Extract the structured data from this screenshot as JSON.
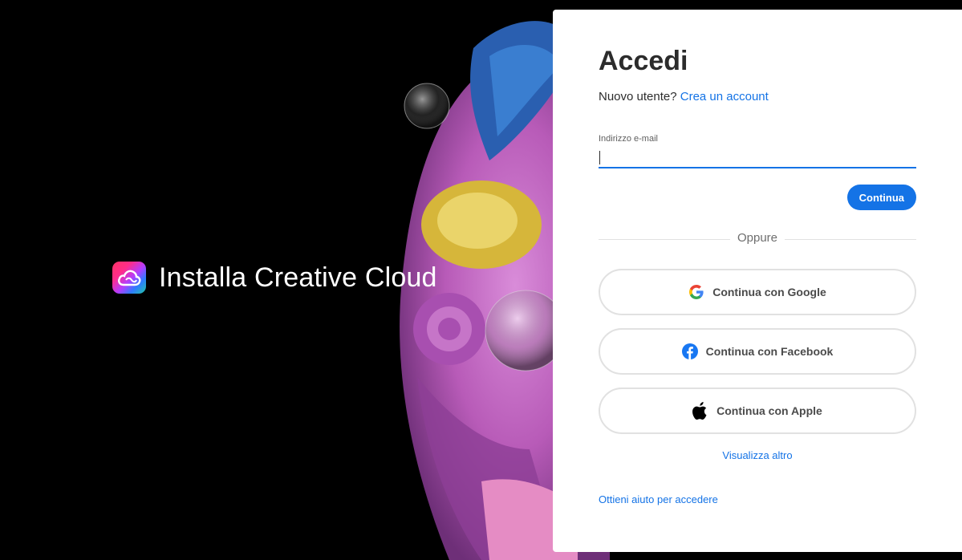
{
  "hero": {
    "title": "Installa Creative Cloud",
    "logo_icon": "creative-cloud-logo"
  },
  "signin": {
    "heading": "Accedi",
    "new_user_text": "Nuovo utente?",
    "create_account_link": "Crea un account",
    "email_label": "Indirizzo e-mail",
    "email_value": "",
    "continue_button": "Continua",
    "divider_text": "Oppure",
    "social": [
      {
        "label": "Continua con Google",
        "icon": "google-icon"
      },
      {
        "label": "Continua con Facebook",
        "icon": "facebook-icon"
      },
      {
        "label": "Continua con Apple",
        "icon": "apple-icon"
      }
    ],
    "show_more_link": "Visualizza altro",
    "help_link": "Ottieni aiuto per accedere"
  },
  "colors": {
    "accent": "#1473e6",
    "background": "#000000",
    "panel": "#ffffff"
  }
}
